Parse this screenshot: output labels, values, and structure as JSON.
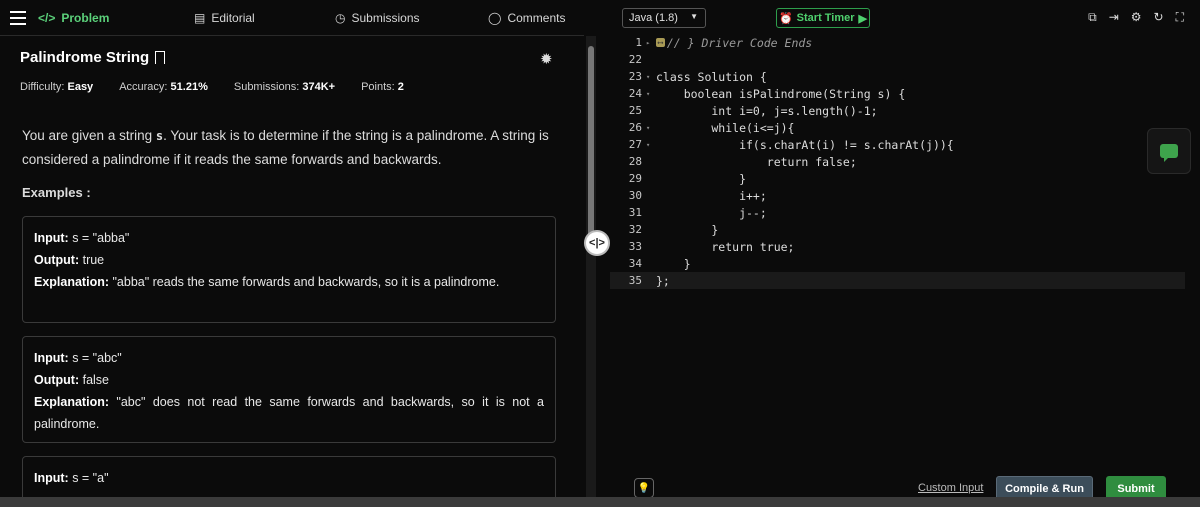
{
  "tabs": {
    "problem": "Problem",
    "editorial": "Editorial",
    "submissions": "Submissions",
    "comments": "Comments"
  },
  "problem": {
    "title": "Palindrome String",
    "difficulty_label": "Difficulty:",
    "difficulty": "Easy",
    "accuracy_label": "Accuracy:",
    "accuracy": "51.21%",
    "submissions_label": "Submissions:",
    "submissions": "374K+",
    "points_label": "Points:",
    "points": "2",
    "desc_pre": "You are given a string ",
    "desc_var": "s",
    "desc_post": ". Your task is to determine if the string is a palindrome. A string is considered a palindrome if it reads the same forwards and backwards.",
    "examples_title": "Examples :"
  },
  "examples": [
    {
      "input_label": "Input:",
      "input": " s = \"abba\"",
      "output_label": "Output:",
      "output": " true",
      "explanation_label": "Explanation:",
      "explanation": " \"abba\" reads the same forwards and backwards, so it is a palindrome."
    },
    {
      "input_label": "Input:",
      "input": " s = \"abc\"",
      "output_label": "Output:",
      "output": " false",
      "explanation_label": "Explanation:",
      "explanation": " \"abc\" does not read the same forwards and backwards, so it is not a palindrome."
    },
    {
      "input_label": "Input:",
      "input": " s = \"a\""
    }
  ],
  "editor": {
    "language": "Java (1.8)",
    "timer": "Start Timer",
    "lines": [
      {
        "n": "1",
        "text": "// } Driver Code Ends"
      },
      {
        "n": "22",
        "text": ""
      },
      {
        "n": "23",
        "text": "class Solution {"
      },
      {
        "n": "24",
        "text": "    boolean isPalindrome(String s) {"
      },
      {
        "n": "25",
        "text": "        int i=0, j=s.length()-1;"
      },
      {
        "n": "26",
        "text": "        while(i<=j){"
      },
      {
        "n": "27",
        "text": "            if(s.charAt(i) != s.charAt(j)){"
      },
      {
        "n": "28",
        "text": "                return false;"
      },
      {
        "n": "29",
        "text": "            }"
      },
      {
        "n": "30",
        "text": "            i++;"
      },
      {
        "n": "31",
        "text": "            j--;"
      },
      {
        "n": "32",
        "text": "        }"
      },
      {
        "n": "33",
        "text": "        return true;"
      },
      {
        "n": "34",
        "text": "    }"
      },
      {
        "n": "35",
        "text": "};"
      }
    ]
  },
  "actions": {
    "custom_input": "Custom Input",
    "compile": "Compile & Run",
    "submit": "Submit"
  }
}
